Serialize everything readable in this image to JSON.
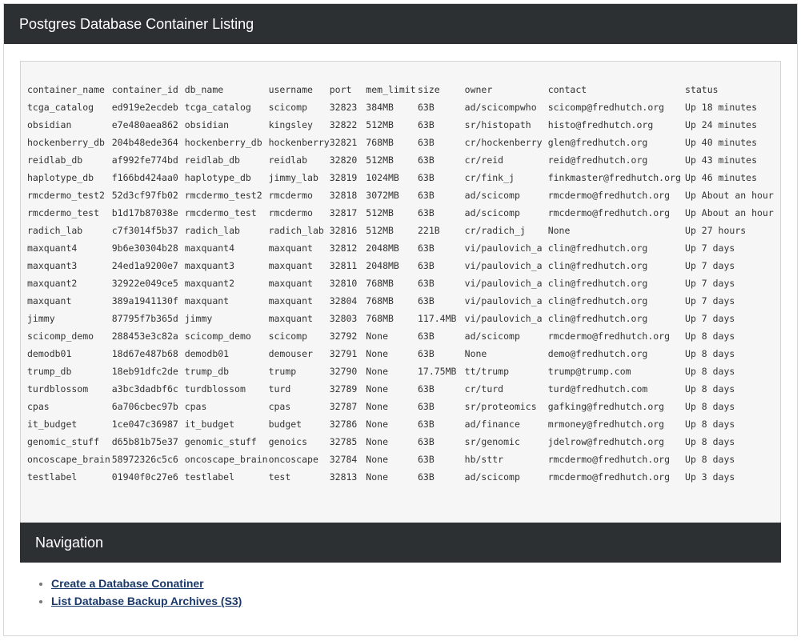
{
  "page": {
    "title": "Postgres Database Container Listing"
  },
  "table": {
    "columns": [
      "container_name",
      "container_id",
      "db_name",
      "username",
      "port",
      "mem_limit",
      "size",
      "owner",
      "contact",
      "status"
    ],
    "rows": [
      [
        "tcga_catalog",
        "ed919e2ecdeb",
        "tcga_catalog",
        "scicomp",
        "32823",
        "384MB",
        "63B",
        "ad/scicompwho",
        "scicomp@fredhutch.org",
        "Up 18 minutes"
      ],
      [
        "obsidian",
        "e7e480aea862",
        "obsidian",
        "kingsley",
        "32822",
        "512MB",
        "63B",
        "sr/histopath",
        "histo@fredhutch.org",
        "Up 24 minutes"
      ],
      [
        "hockenberry_db",
        "204b48ede364",
        "hockenberry_db",
        "hockenberry",
        "32821",
        "768MB",
        "63B",
        "cr/hockenberry",
        "glen@fredhutch.org",
        "Up 40 minutes"
      ],
      [
        "reidlab_db",
        "af992fe774bd",
        "reidlab_db",
        "reidlab",
        "32820",
        "512MB",
        "63B",
        "cr/reid",
        "reid@fredhutch.org",
        "Up 43 minutes"
      ],
      [
        "haplotype_db",
        "f166bd424aa0",
        "haplotype_db",
        "jimmy_lab",
        "32819",
        "1024MB",
        "63B",
        "cr/fink_j",
        "finkmaster@fredhutch.org",
        "Up 46 minutes"
      ],
      [
        "rmcdermo_test2",
        "52d3cf97fb02",
        "rmcdermo_test2",
        "rmcdermo",
        "32818",
        "3072MB",
        "63B",
        "ad/scicomp",
        "rmcdermo@fredhutch.org",
        "Up About an hour"
      ],
      [
        "rmcdermo_test",
        "b1d17b87038e",
        "rmcdermo_test",
        "rmcdermo",
        "32817",
        "512MB",
        "63B",
        "ad/scicomp",
        "rmcdermo@fredhutch.org",
        "Up About an hour"
      ],
      [
        "radich_lab",
        "c7f3014f5b37",
        "radich_lab",
        "radich_lab",
        "32816",
        "512MB",
        "221B",
        "cr/radich_j",
        "None",
        "Up 27 hours"
      ],
      [
        "maxquant4",
        "9b6e30304b28",
        "maxquant4",
        "maxquant",
        "32812",
        "2048MB",
        "63B",
        "vi/paulovich_a",
        "clin@fredhutch.org",
        "Up 7 days"
      ],
      [
        "maxquant3",
        "24ed1a9200e7",
        "maxquant3",
        "maxquant",
        "32811",
        "2048MB",
        "63B",
        "vi/paulovich_a",
        "clin@fredhutch.org",
        "Up 7 days"
      ],
      [
        "maxquant2",
        "32922e049ce5",
        "maxquant2",
        "maxquant",
        "32810",
        "768MB",
        "63B",
        "vi/paulovich_a",
        "clin@fredhutch.org",
        "Up 7 days"
      ],
      [
        "maxquant",
        "389a1941130f",
        "maxquant",
        "maxquant",
        "32804",
        "768MB",
        "63B",
        "vi/paulovich_a",
        "clin@fredhutch.org",
        "Up 7 days"
      ],
      [
        "jimmy",
        "87795f7b365d",
        "jimmy",
        "maxquant",
        "32803",
        "768MB",
        "117.4MB",
        "vi/paulovich_a",
        "clin@fredhutch.org",
        "Up 7 days"
      ],
      [
        "scicomp_demo",
        "288453e3c82a",
        "scicomp_demo",
        "scicomp",
        "32792",
        "None",
        "63B",
        "ad/scicomp",
        "rmcdermo@fredhutch.org",
        "Up 8 days"
      ],
      [
        "demodb01",
        "18d67e487b68",
        "demodb01",
        "demouser",
        "32791",
        "None",
        "63B",
        "None",
        "demo@fredhutch.org",
        "Up 8 days"
      ],
      [
        "trump_db",
        "18eb91dfc2de",
        "trump_db",
        "trump",
        "32790",
        "None",
        "17.75MB",
        "tt/trump",
        "trump@trump.com",
        "Up 8 days"
      ],
      [
        "turdblossom",
        "a3bc3dadbf6c",
        "turdblossom",
        "turd",
        "32789",
        "None",
        "63B",
        "cr/turd",
        "turd@fredhutch.com",
        "Up 8 days"
      ],
      [
        "cpas",
        "6a706cbec97b",
        "cpas",
        "cpas",
        "32787",
        "None",
        "63B",
        "sr/proteomics",
        "gafking@fredhutch.org",
        "Up 8 days"
      ],
      [
        "it_budget",
        "1ce047c36987",
        "it_budget",
        "budget",
        "32786",
        "None",
        "63B",
        "ad/finance",
        "mrmoney@fredhutch.org",
        "Up 8 days"
      ],
      [
        "genomic_stuff",
        "d65b81b75e37",
        "genomic_stuff",
        "genoics",
        "32785",
        "None",
        "63B",
        "sr/genomic",
        "jdelrow@fredhutch.org",
        "Up 8 days"
      ],
      [
        "oncoscape_brain",
        "58972326c5c6",
        "oncoscape_brain",
        "oncoscape",
        "32784",
        "None",
        "63B",
        "hb/sttr",
        "rmcdermo@fredhutch.org",
        "Up 8 days"
      ],
      [
        "testlabel",
        "01940f0c27e6",
        "testlabel",
        "test",
        "32813",
        "None",
        "63B",
        "ad/scicomp",
        "rmcdermo@fredhutch.org",
        "Up 3 days"
      ]
    ]
  },
  "navigation": {
    "title": "Navigation",
    "links": [
      {
        "label": "Create a Database Conatiner"
      },
      {
        "label": "List Database Backup Archives (S3)"
      }
    ]
  }
}
